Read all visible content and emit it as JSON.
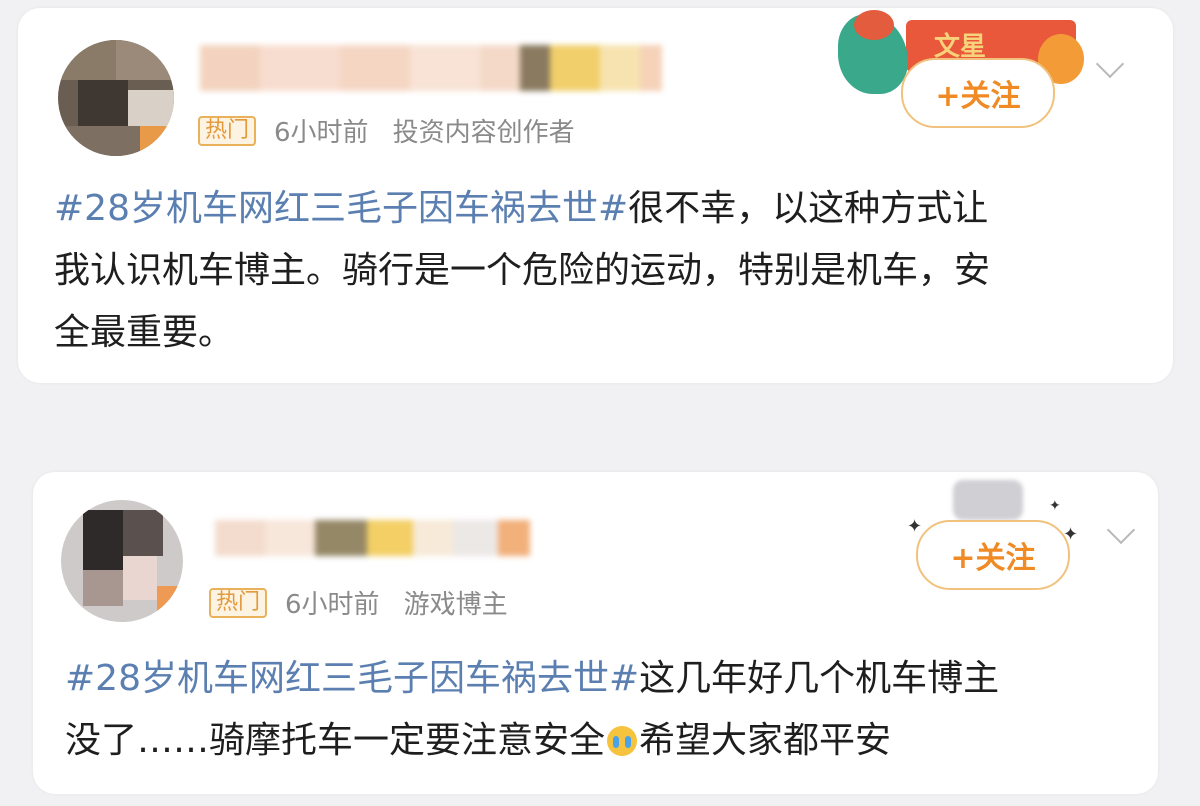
{
  "posts": [
    {
      "badge": "热门",
      "time": "6小时前",
      "category": "投资内容创作者",
      "follow_label": "+关注",
      "banner_text": "文星",
      "hashtag": "#28岁机车网红三毛子因车祸去世#",
      "text_lines": [
        "很不幸，以这种方式让",
        "我认识机车博主。骑行是一个危险的运动，特别是机车，安",
        "全最重要。"
      ]
    },
    {
      "badge": "热门",
      "time": "6小时前",
      "category": "游戏博主",
      "follow_label": "+关注",
      "hashtag": "#28岁机车网红三毛子因车祸去世#",
      "text_lines": [
        "这几年好几个机车博主",
        "没了……骑摩托车一定要注意安全",
        "希望大家都平安"
      ]
    }
  ],
  "icons": {
    "chevron": "chevron-down-icon",
    "emoji": "crying-face-emoji-icon",
    "avatar": "avatar"
  },
  "colors": {
    "hashtag": "#5b7fb0",
    "follow": "#f08a24",
    "badge": "#e39a3c"
  }
}
